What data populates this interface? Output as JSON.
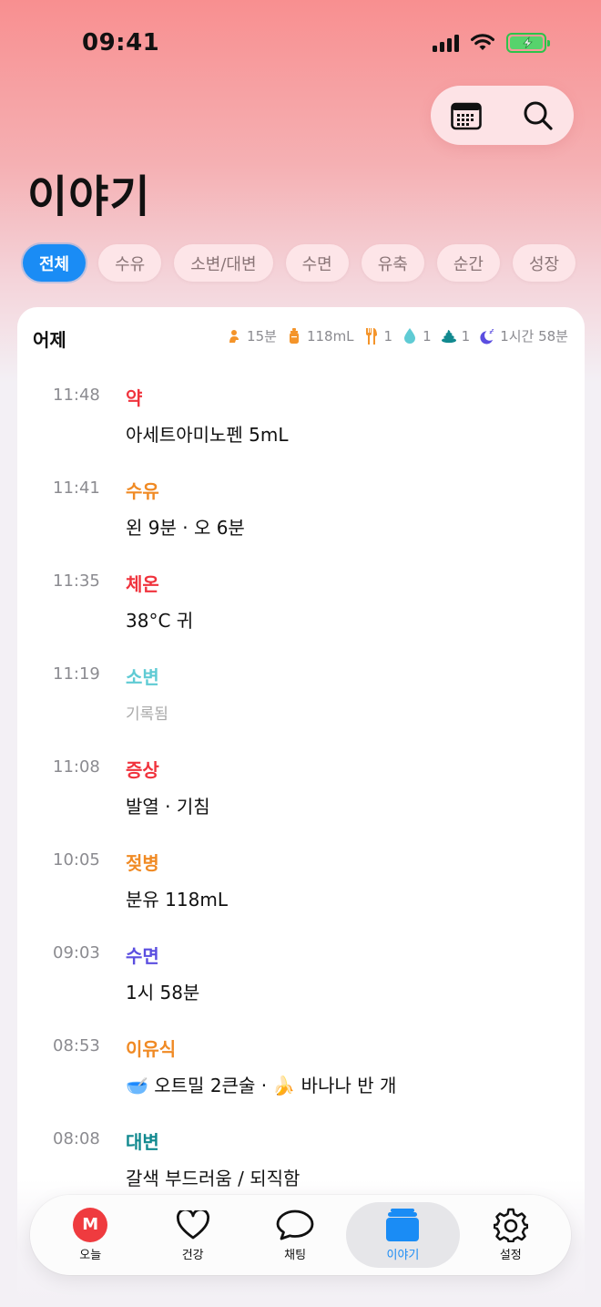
{
  "status_bar": {
    "time": "09:41"
  },
  "page": {
    "title": "이야기"
  },
  "filters": [
    {
      "label": "전체",
      "active": true
    },
    {
      "label": "수유",
      "active": false
    },
    {
      "label": "소변/대변",
      "active": false
    },
    {
      "label": "수면",
      "active": false
    },
    {
      "label": "유축",
      "active": false
    },
    {
      "label": "순간",
      "active": false
    },
    {
      "label": "성장",
      "active": false
    }
  ],
  "day_card": {
    "label": "어제",
    "summary": {
      "breastfeeding": "15분",
      "bottle": "118mL",
      "solids": "1",
      "urine": "1",
      "stool": "1",
      "sleep": "1시간 58분"
    },
    "entries": [
      {
        "time": "11:48",
        "category": "약",
        "color": "#f0333d",
        "detail": "아세트아미노펜 5mL"
      },
      {
        "time": "11:41",
        "category": "수유",
        "color": "#f08a24",
        "detail": "왼 9분 · 오 6분"
      },
      {
        "time": "11:35",
        "category": "체온",
        "color": "#f0333d",
        "detail": "38°C 귀"
      },
      {
        "time": "11:19",
        "category": "소변",
        "color": "#5fcbd4",
        "detail": "기록됨",
        "muted": true
      },
      {
        "time": "11:08",
        "category": "증상",
        "color": "#f0333d",
        "detail": "발열 · 기침"
      },
      {
        "time": "10:05",
        "category": "젖병",
        "color": "#f08a24",
        "detail": "분유 118mL"
      },
      {
        "time": "09:03",
        "category": "수면",
        "color": "#5b4ee0",
        "detail": "1시 58분"
      },
      {
        "time": "08:53",
        "category": "이유식",
        "color": "#f08a24",
        "detail": "🥣 오트밀 2큰술 · 🍌 바나나 반 개"
      },
      {
        "time": "08:08",
        "category": "대변",
        "color": "#11898f",
        "detail": "갈색 부드러움 / 되직함"
      }
    ]
  },
  "tabbar": {
    "avatar_initial": "M",
    "tabs": [
      {
        "label": "오늘",
        "icon": "avatar-icon"
      },
      {
        "label": "건강",
        "icon": "heart-icon"
      },
      {
        "label": "채팅",
        "icon": "chat-bubble-icon"
      },
      {
        "label": "이야기",
        "icon": "stack-icon",
        "active": true
      },
      {
        "label": "설정",
        "icon": "gear-icon"
      }
    ]
  }
}
